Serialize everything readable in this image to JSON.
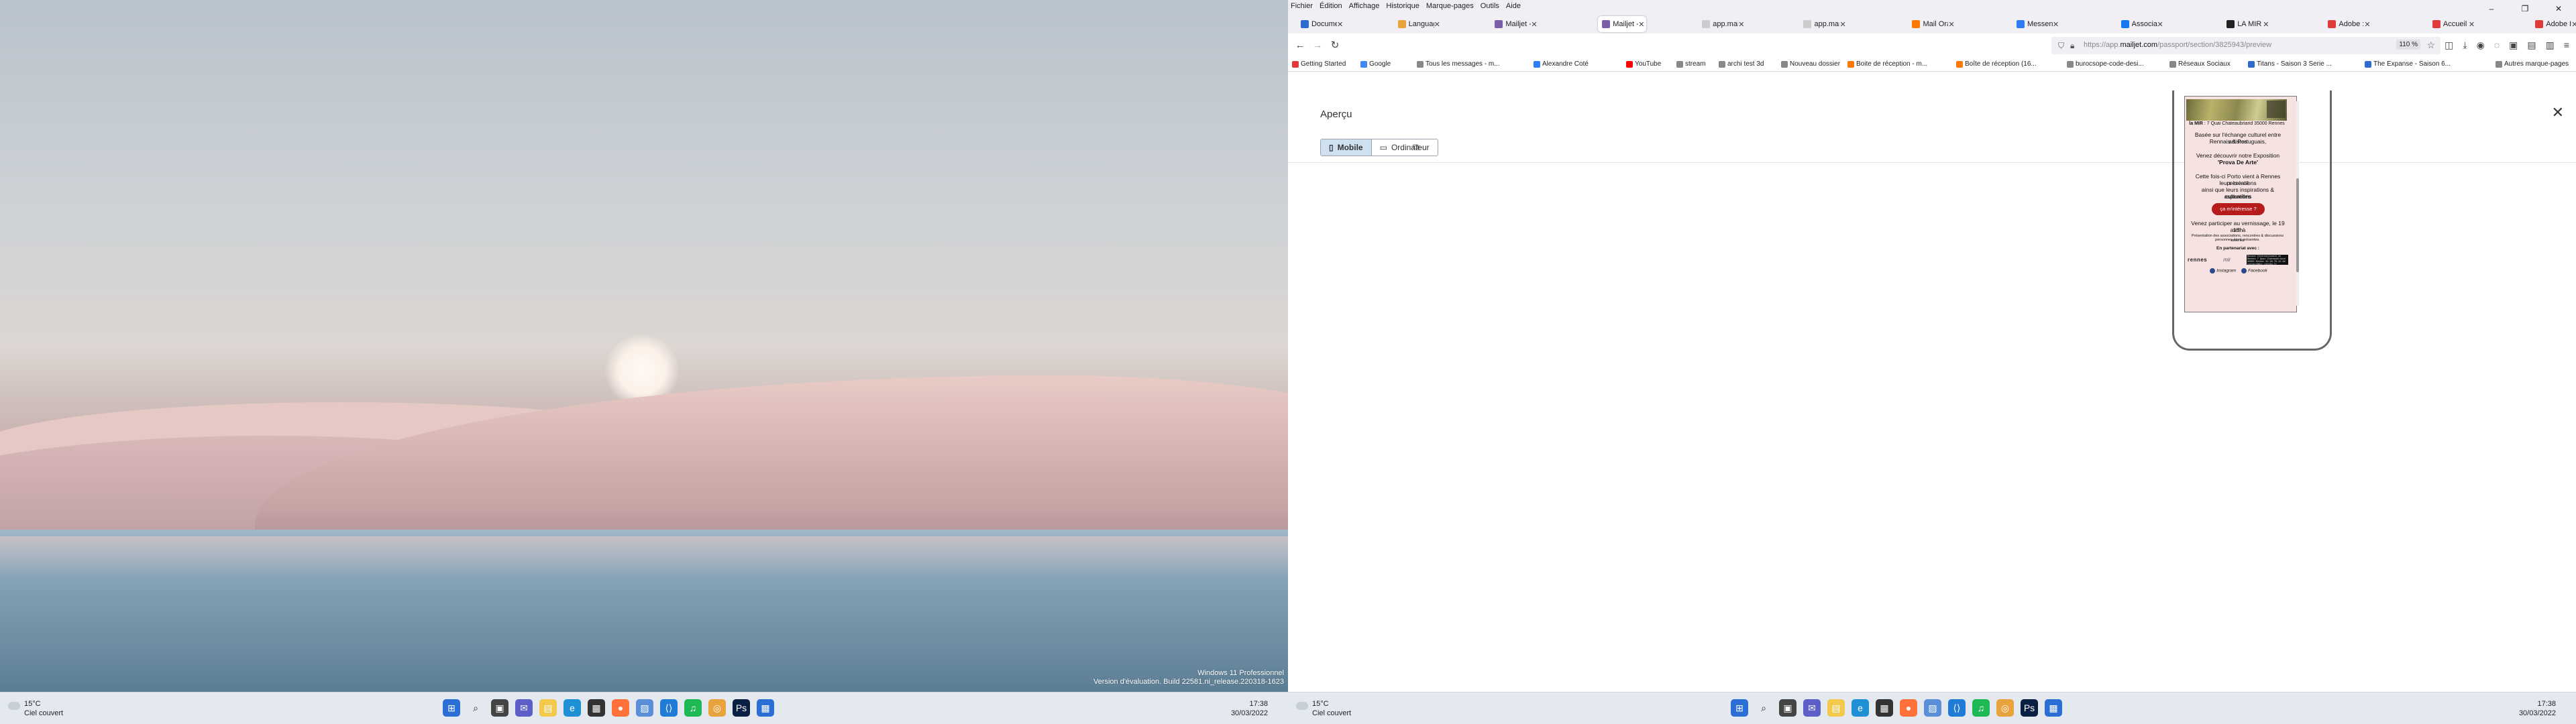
{
  "left_monitor": {
    "watermark": {
      "line1": "Windows 11 Professionnel",
      "line2": "Version d'évaluation. Build 22581.ni_release.220318-1623"
    }
  },
  "taskbar": {
    "weather_temp": "15°C",
    "weather_desc": "Ciel couvert",
    "time": "17:38",
    "date": "30/03/2022"
  },
  "browser": {
    "menu": [
      "Fichier",
      "Édition",
      "Affichage",
      "Historique",
      "Marque-pages",
      "Outils",
      "Aide"
    ],
    "tabs": [
      {
        "label": "Documentation",
        "color": "#2e6bd1"
      },
      {
        "label": "Language Packs",
        "color": "#e8a33d"
      },
      {
        "label": "Mailjet - Emails",
        "color": "#7b5ea7"
      },
      {
        "label": "Mailjet - Passport",
        "color": "#7b5ea7"
      },
      {
        "label": "app.mailjet.com/pa",
        "color": "#cccccc"
      },
      {
        "label": "app.mailjet.com/pa",
        "color": "#cccccc"
      },
      {
        "label": "Mail Orange",
        "color": "#ff7900"
      },
      {
        "label": "Messenger | Face",
        "color": "#2e7cf6"
      },
      {
        "label": "Association L'Ut",
        "color": "#1877f2"
      },
      {
        "label": "LA MIR",
        "color": "#222222"
      },
      {
        "label": "Adobe : outils de",
        "color": "#e03a3a"
      },
      {
        "label": "Accueil | Adobe E",
        "color": "#e03a3a"
      },
      {
        "label": "Adobe ID",
        "color": "#e03a3a"
      }
    ],
    "url_prefix": "https://app.",
    "url_domain": "mailjet.com",
    "url_path": "/passport/section/3825943/preview",
    "zoom": "110 %",
    "bookmarks": [
      "Getting Started",
      "Google",
      "Tous les messages - m...",
      "Alexandre Coté",
      "YouTube",
      "stream",
      "archi test 3d",
      "Nouveau dossier",
      "Boite de réception - m...",
      "Boîte de réception (16...",
      "burocsope-code-desi...",
      "Réseaux Sociaux",
      "Titans - Saison 3 Serie ...",
      "The Expanse - Saison 6...",
      "Autres marque-pages"
    ]
  },
  "preview": {
    "title": "Aperçu",
    "btn_mobile": "Mobile",
    "btn_desktop": "Ordinateur"
  },
  "email": {
    "address_bold": "la MIR",
    "address": " : 7 Quai Chateaubriand 35000 Rennes",
    "p1_line1": "Basée sur l'échange culturel entre artistes",
    "p1_line2": "Rennais & Portuguais,",
    "p2_line1": "Venez découvrir notre Exposition",
    "p2_line2": "'Prova De Arte'",
    "p3_line1": "Cette fois-ci Porto vient à Rennes présenté",
    "p3_line2": "leurs créations",
    "p3_line3": "ainsi que leurs inspirations & aspirations",
    "p3_line4": "culturelles",
    "button": "ça m'intéresse ?",
    "p4_line1": "Venez participer au vernissage, le 19 avril à",
    "p4_line2": "18h",
    "small_line1": "Présentation des associations, rencontres & discussions avec les",
    "small_line2": "personnes étant présentes.",
    "partners": "En partenariat avec :",
    "logo_rennes": "rennes",
    "logo_mir": "mir",
    "logo3": "Maison Internationale de Rennes 7 Quai Chateaubriand 35000 Rennes 02.99.78.22.66 contact@mir-rennes.fr",
    "instagram": "Instagram",
    "facebook": "Facebook"
  }
}
